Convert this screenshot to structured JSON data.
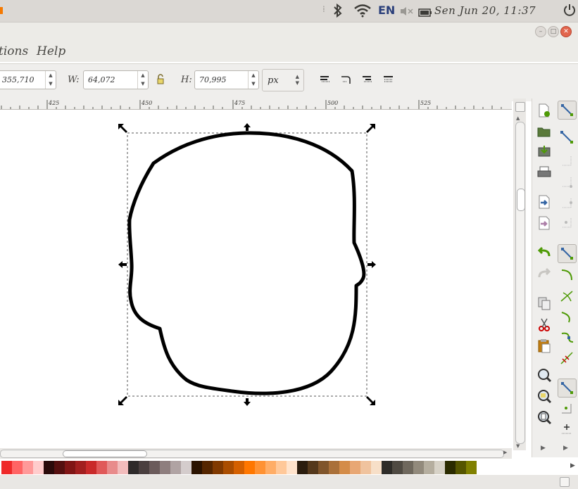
{
  "top_panel": {
    "language": "EN",
    "clock": "Sen  Jun 20, 11:37"
  },
  "menubar": {
    "items": [
      "tions",
      "Help"
    ]
  },
  "controls": {
    "y_value": "355,710",
    "w_label": "W:",
    "w_value": "64,072",
    "h_label": "H:",
    "h_value": "70,995",
    "unit": "px"
  },
  "ruler": {
    "labels": [
      "425",
      "450",
      "475",
      "500",
      "525"
    ]
  },
  "colors": {
    "palette": [
      "#ef2929",
      "#ff6464",
      "#ff9999",
      "#ffcccc",
      "#2b0a0a",
      "#550f0f",
      "#801515",
      "#a21f1f",
      "#c92a2a",
      "#e05959",
      "#e88b8b",
      "#f2bcbc",
      "#2e2a2a",
      "#4a3f3f",
      "#6b5b5b",
      "#8e7e7e",
      "#b0a3a3",
      "#d4cccc",
      "#2b1300",
      "#552600",
      "#803900",
      "#aa4d00",
      "#d46000",
      "#ff7700",
      "#ff9233",
      "#ffad66",
      "#ffc899",
      "#ffe3cc",
      "#2b1d0e",
      "#55391c",
      "#80552b",
      "#aa7039",
      "#d48c48",
      "#e8a774",
      "#f0c39e",
      "#f7dfc8",
      "#2e2c28",
      "#4f4a42",
      "#6f685d",
      "#928a7c",
      "#b5ae9f",
      "#d7d2c7",
      "#2b2b00",
      "#555500",
      "#808000"
    ]
  }
}
